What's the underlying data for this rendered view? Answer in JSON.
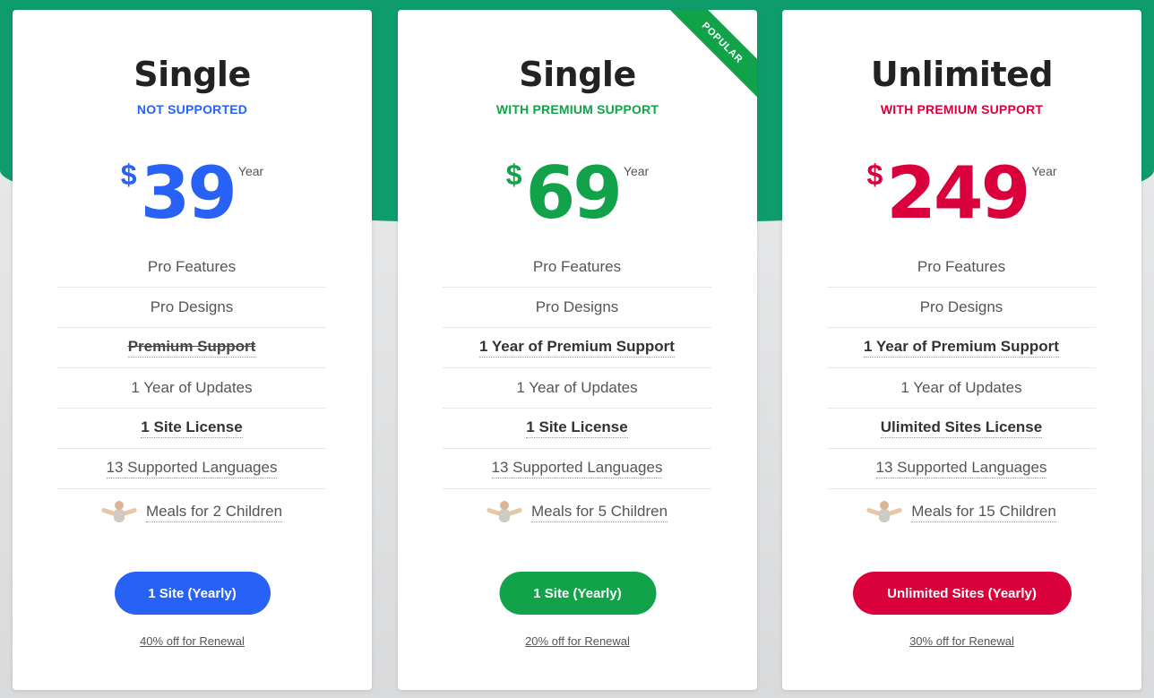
{
  "plans": [
    {
      "title": "Single",
      "subtitle": "NOT SUPPORTED",
      "accent": "#2761f5",
      "currency": "$",
      "amount": "39",
      "period": "Year",
      "features": [
        {
          "text": "Pro Features",
          "style": "plain"
        },
        {
          "text": "Pro Designs",
          "style": "plain"
        },
        {
          "text": "Premium Support",
          "style": "strike"
        },
        {
          "text": "1 Year of Updates",
          "style": "plain"
        },
        {
          "text": "1 Site License",
          "style": "bold"
        },
        {
          "text": "13 Supported Languages",
          "style": "dotted"
        },
        {
          "text": "Meals for 2 Children",
          "style": "meal"
        }
      ],
      "cta": "1 Site (Yearly)",
      "renewal": "40% off for Renewal"
    },
    {
      "title": "Single",
      "subtitle": "WITH PREMIUM SUPPORT",
      "accent": "#12a24a",
      "currency": "$",
      "amount": "69",
      "period": "Year",
      "ribbon": "POPULAR",
      "features": [
        {
          "text": "Pro Features",
          "style": "plain"
        },
        {
          "text": "Pro Designs",
          "style": "plain"
        },
        {
          "text": "1 Year of Premium Support",
          "style": "bold"
        },
        {
          "text": "1 Year of Updates",
          "style": "plain"
        },
        {
          "text": "1 Site License",
          "style": "bold"
        },
        {
          "text": "13 Supported Languages",
          "style": "dotted"
        },
        {
          "text": "Meals for 5 Children",
          "style": "meal"
        }
      ],
      "cta": "1 Site (Yearly)",
      "renewal": "20% off for Renewal"
    },
    {
      "title": "Unlimited",
      "subtitle": "WITH PREMIUM SUPPORT",
      "accent": "#d9003b",
      "currency": "$",
      "amount": "249",
      "period": "Year",
      "features": [
        {
          "text": "Pro Features",
          "style": "plain"
        },
        {
          "text": "Pro Designs",
          "style": "plain"
        },
        {
          "text": "1 Year of Premium Support",
          "style": "bold"
        },
        {
          "text": "1 Year of Updates",
          "style": "plain"
        },
        {
          "text": "Ulimited Sites License",
          "style": "bold"
        },
        {
          "text": "13 Supported Languages",
          "style": "dotted"
        },
        {
          "text": "Meals for 15 Children",
          "style": "meal"
        }
      ],
      "cta": "Unlimited Sites (Yearly)",
      "renewal": "30% off for Renewal"
    }
  ],
  "colors": {
    "header_bg": "#0f9c6c",
    "page_bg": "#e6e7e8"
  },
  "icons": {
    "meal": "child-meal-icon"
  }
}
